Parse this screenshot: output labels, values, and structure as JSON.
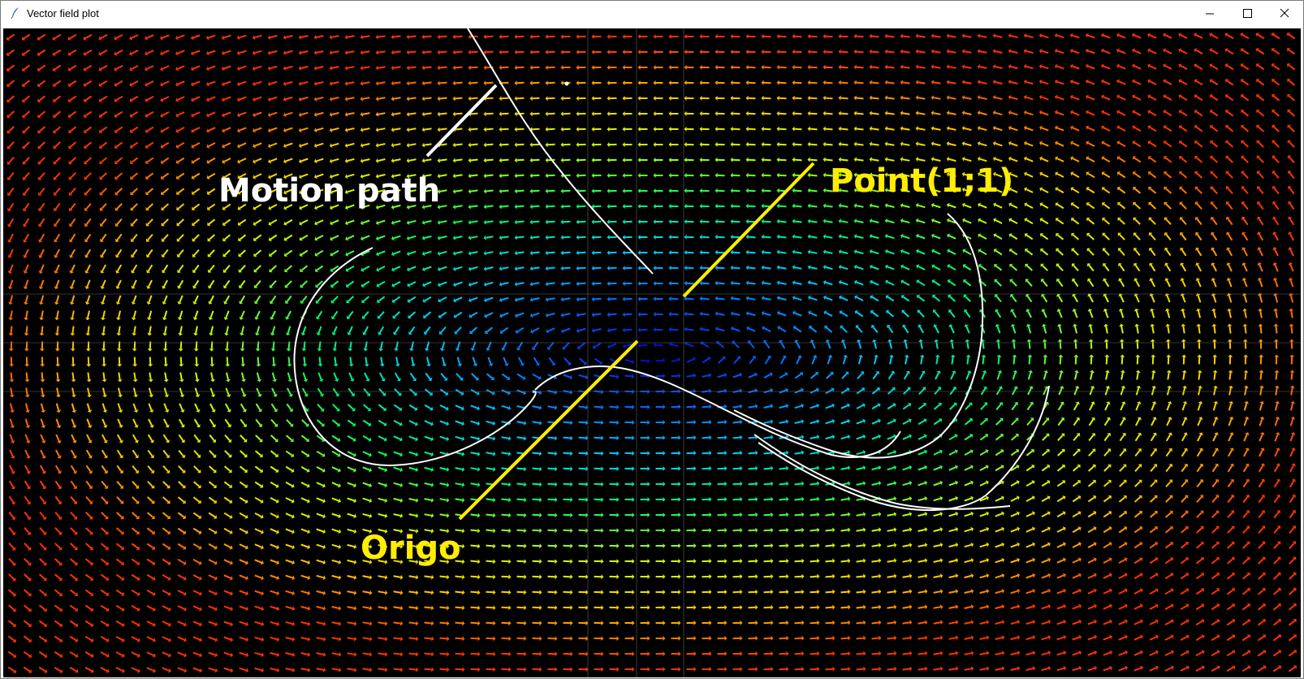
{
  "window": {
    "title": "Vector field plot",
    "icons": {
      "app": "feather-icon",
      "minimize": "minimize-icon",
      "maximize": "maximize-icon",
      "close": "close-icon"
    }
  },
  "annotations": {
    "motion_path": "Motion path",
    "point": "Point(1;1)",
    "origin": "Origo"
  },
  "colors": {
    "background": "#000000",
    "path": "#ffffff",
    "annotation_yellow": "#ffee00",
    "colormap": [
      "#0000cc",
      "#0066ff",
      "#00ccff",
      "#00ff66",
      "#ccff00",
      "#ffcc00",
      "#ff3300"
    ]
  }
}
